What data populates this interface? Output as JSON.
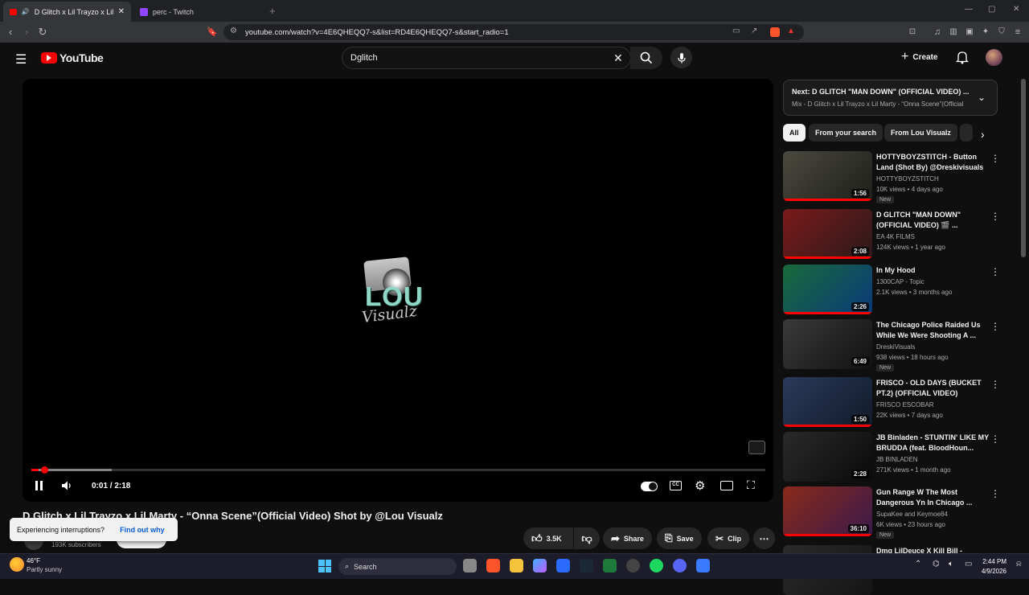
{
  "browser": {
    "tabs": [
      {
        "title": "D Glitch x Lil Trayzo x Lil Marty",
        "active": true
      },
      {
        "title": "perc - Twitch",
        "active": false
      }
    ],
    "url": "youtube.com/watch?v=4E6QHEQQ7-s&list=RD4E6QHEQQ7-s&start_radio=1"
  },
  "youtube": {
    "logo": "YouTube",
    "search_value": "Dglitch",
    "create_label": "Create"
  },
  "player": {
    "time": "0:01 / 2:18",
    "logo_text_top": "LOU",
    "logo_text_bottom": "Visualz",
    "progress_fraction": 0.01,
    "buffered_fraction": 0.11
  },
  "video": {
    "title": "D Glitch x Lil Trayzo x Lil Marty - “Onna Scene”(Official Video) Shot by @Lou Visualz",
    "subscribers": "193K subscribers",
    "likes": "3.5K",
    "share": "Share",
    "save": "Save",
    "clip": "Clip"
  },
  "toast": {
    "text": "Experiencing interruptions?",
    "link": "Find out why"
  },
  "sidebar": {
    "next_label": "Next: D GLITCH \"MAN DOWN\" (OFFICIAL VIDEO) ...",
    "next_sub": "Mix - D Glitch x Lil Trayzo x Lil Marty - “Onna Scene”(Official ...",
    "chips": [
      "All",
      "From your search",
      "From Lou Visualz"
    ],
    "videos": [
      {
        "title": "HOTTYBOYZSTITCH - Button Land (Shot By) @Dreskivisuals",
        "channel": "HOTTYBOYZSTITCH",
        "meta": "10K views • 4 days ago",
        "new": "New",
        "duration": "1:56",
        "colors": [
          "#4a4a40",
          "#1e1e1a"
        ]
      },
      {
        "title": "D GLITCH \"MAN DOWN\" (OFFICIAL VIDEO) 🎬 ...",
        "channel": "EA 4K FILMS",
        "meta": "124K views • 1 year ago",
        "new": "",
        "duration": "2:08",
        "colors": [
          "#7a1a1a",
          "#2a1a1a"
        ]
      },
      {
        "title": "In My Hood",
        "channel": "1300CAP - Topic",
        "meta": "2.1K views • 3 months ago",
        "new": "",
        "duration": "2:26",
        "colors": [
          "#1a6a3a",
          "#0a3a7a"
        ]
      },
      {
        "title": "The Chicago Police Raided Us While We Were Shooting A ...",
        "channel": "DreskiVisuals",
        "meta": "938 views • 18 hours ago",
        "new": "New",
        "duration": "6:49",
        "colors": [
          "#3a3a3a",
          "#111111"
        ]
      },
      {
        "title": "FRISCO - OLD DAYS (BUCKET PT.2) (OFFICIAL VIDEO)",
        "channel": "FRISCO ESCOBAR",
        "meta": "22K views • 7 days ago",
        "new": "",
        "duration": "1:50",
        "colors": [
          "#2a3a5a",
          "#101a2a"
        ]
      },
      {
        "title": "JB Binladen - STUNTIN' LIKE MY BRUDDA (feat. BloodHoun...",
        "channel": "JB BINLADEN",
        "meta": "271K views • 1 month ago",
        "new": "",
        "duration": "2:28",
        "colors": [
          "#2a2a2a",
          "#0a0a0a"
        ]
      },
      {
        "title": "Gun Range W The Most Dangerous Yn In Chicago ...",
        "channel": "SupaKee and Keymoe84",
        "meta": "6K views • 23 hours ago",
        "new": "New",
        "duration": "36:10",
        "colors": [
          "#8a2a1a",
          "#3a1a4a"
        ]
      },
      {
        "title": "Dmg LilDeuce X Kill Bill -",
        "channel": "",
        "meta": "",
        "new": "",
        "duration": "",
        "colors": [
          "#2a2a2a",
          "#151515"
        ]
      }
    ]
  },
  "taskbar": {
    "weather_temp": "46°F",
    "weather_desc": "Partly sunny",
    "search": "Search",
    "time": "2:44 PM",
    "date": "4/9/2026"
  }
}
